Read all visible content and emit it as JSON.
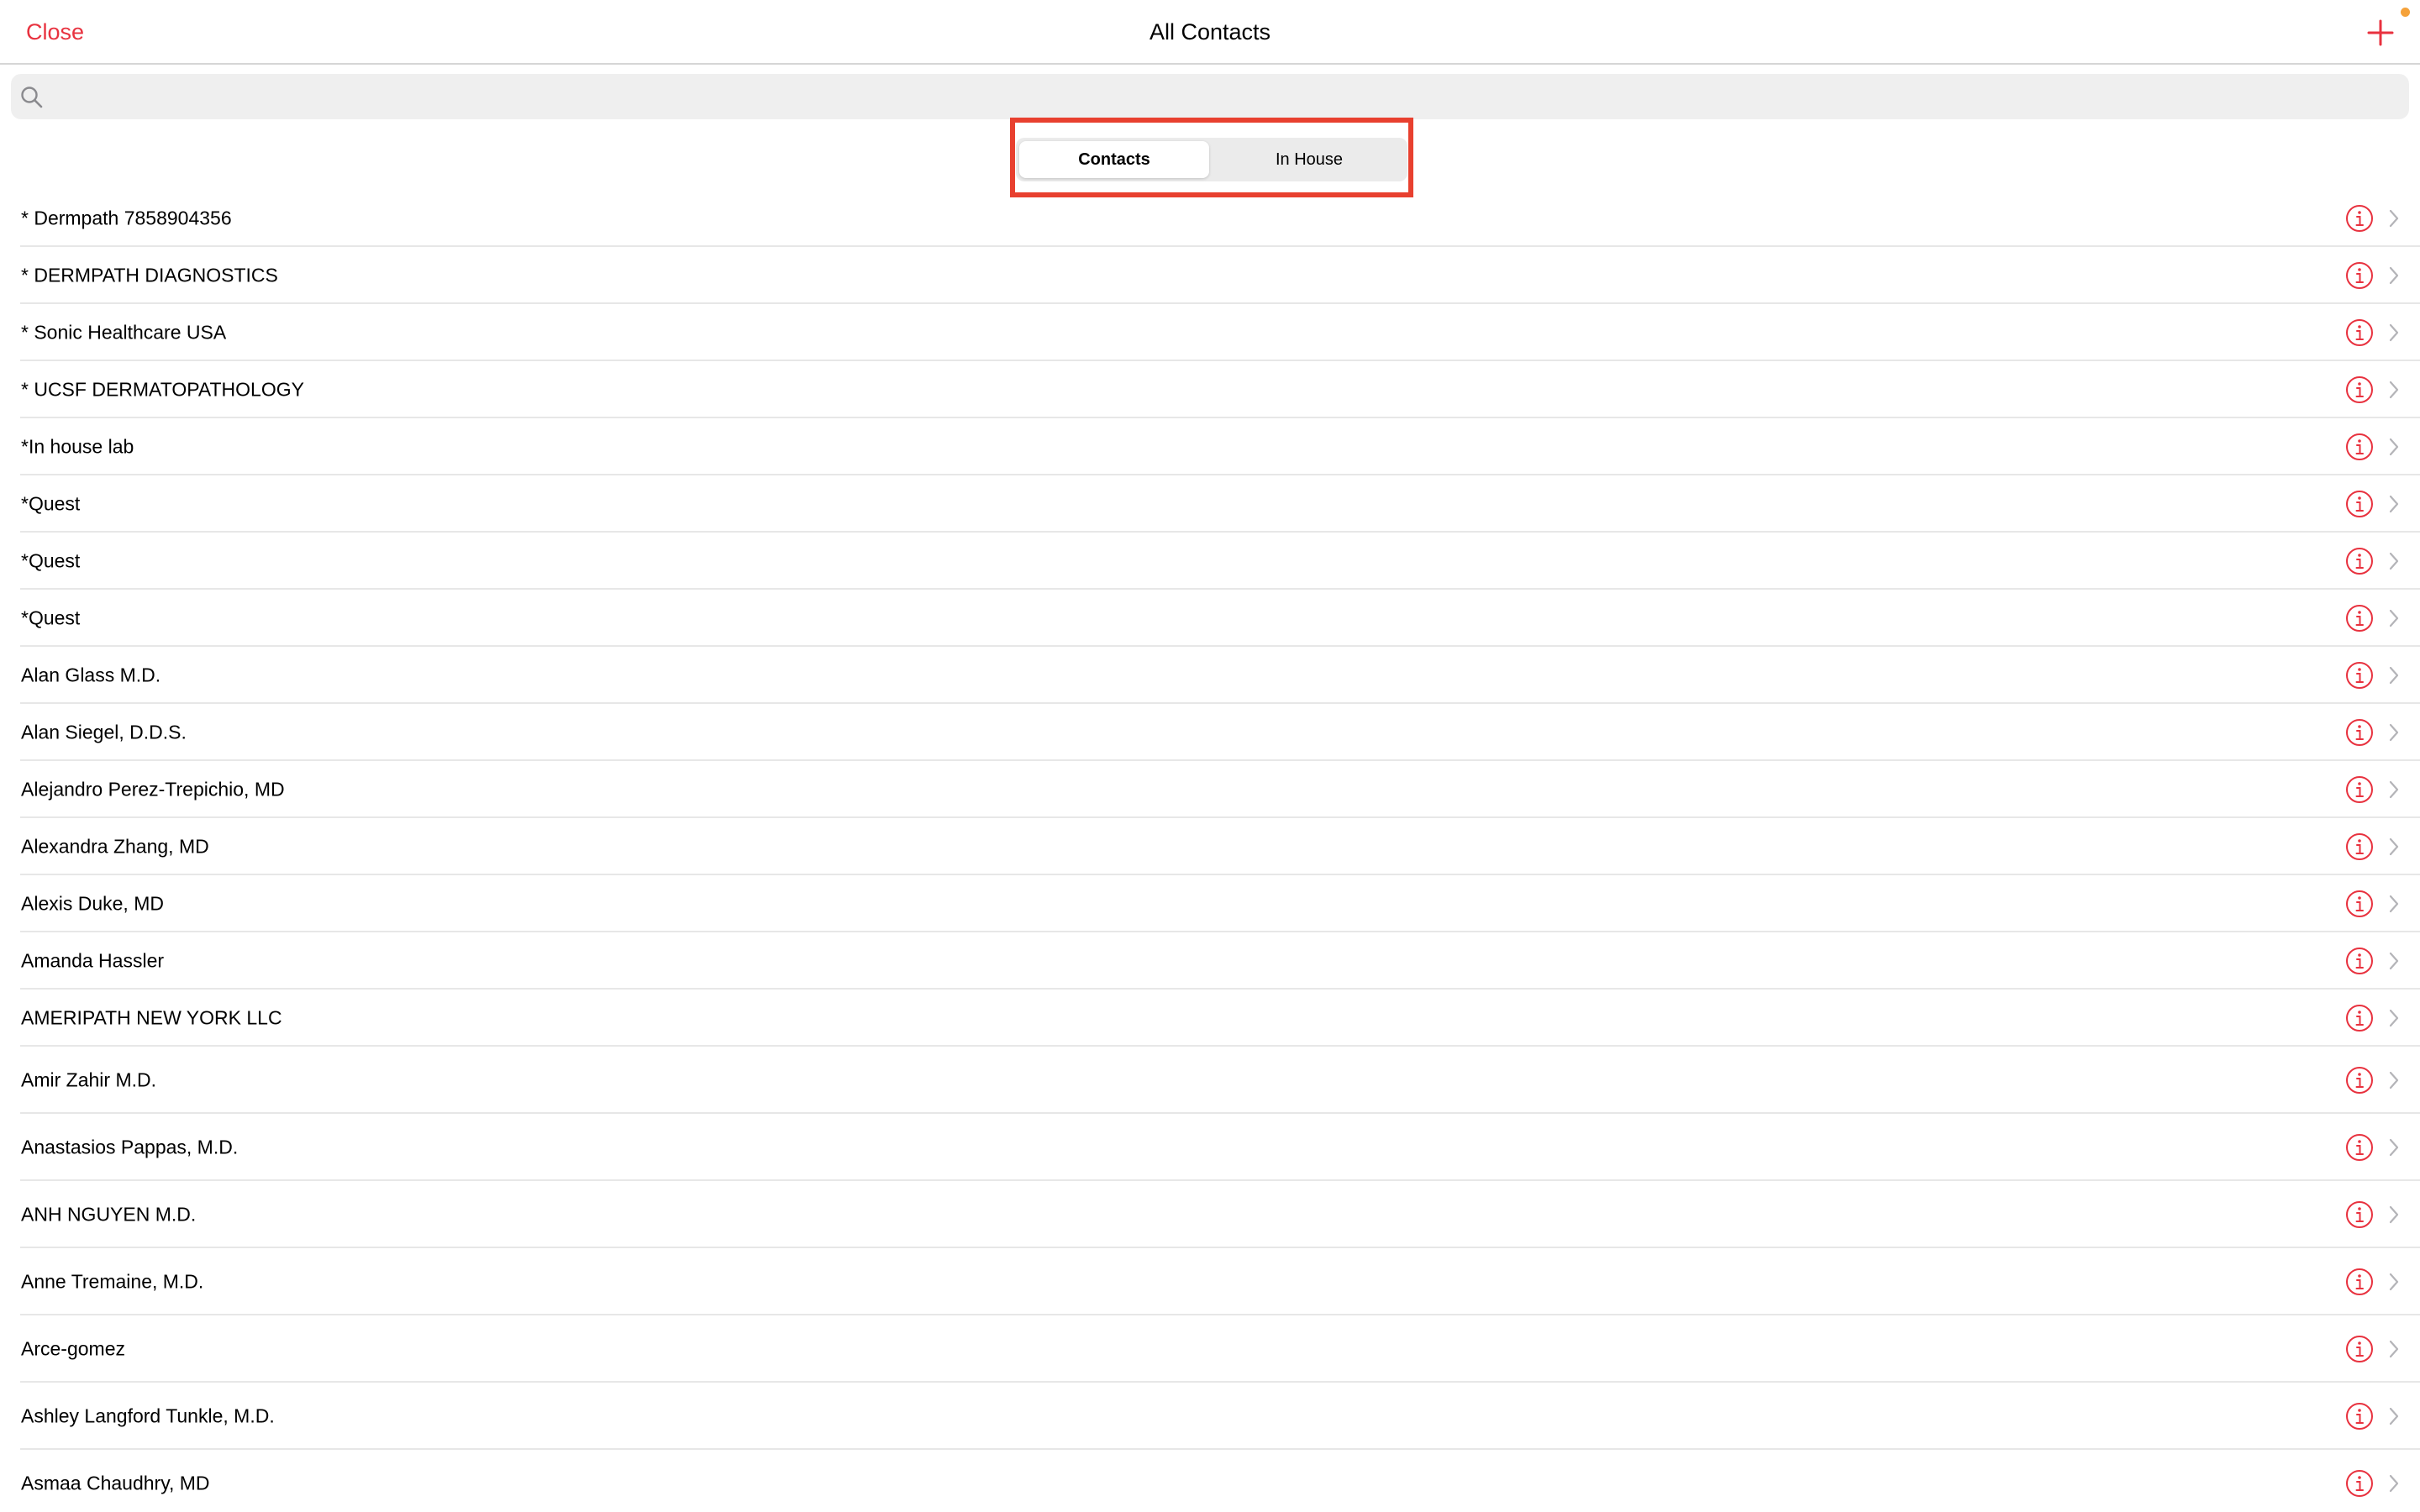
{
  "nav": {
    "close_label": "Close",
    "title": "All Contacts",
    "add_icon": "plus-icon"
  },
  "search": {
    "icon": "search-icon",
    "placeholder": "",
    "value": ""
  },
  "segments": [
    {
      "label": "Contacts",
      "selected": true
    },
    {
      "label": "In House",
      "selected": false
    }
  ],
  "colors": {
    "accent": "#e8323f",
    "highlight_box": "#e8402f",
    "notification_dot": "#f5a23a"
  },
  "contacts": [
    {
      "name": "* Dermpath 7858904356"
    },
    {
      "name": "* DERMPATH DIAGNOSTICS"
    },
    {
      "name": "* Sonic Healthcare USA"
    },
    {
      "name": "* UCSF DERMATOPATHOLOGY"
    },
    {
      "name": "*In house lab"
    },
    {
      "name": "*Quest"
    },
    {
      "name": "*Quest"
    },
    {
      "name": "*Quest"
    },
    {
      "name": "Alan Glass M.D."
    },
    {
      "name": "Alan Siegel, D.D.S."
    },
    {
      "name": "Alejandro Perez-Trepichio, MD"
    },
    {
      "name": "Alexandra Zhang, MD"
    },
    {
      "name": "Alexis Duke, MD"
    },
    {
      "name": "Amanda Hassler"
    },
    {
      "name": "AMERIPATH NEW YORK LLC"
    },
    {
      "name": "Amir Zahir M.D."
    },
    {
      "name": "Anastasios Pappas, M.D."
    },
    {
      "name": "ANH NGUYEN M.D."
    },
    {
      "name": "Anne Tremaine, M.D."
    },
    {
      "name": "Arce-gomez"
    },
    {
      "name": "Ashley Langford Tunkle, M.D."
    },
    {
      "name": "Asmaa Chaudhry, MD"
    }
  ]
}
